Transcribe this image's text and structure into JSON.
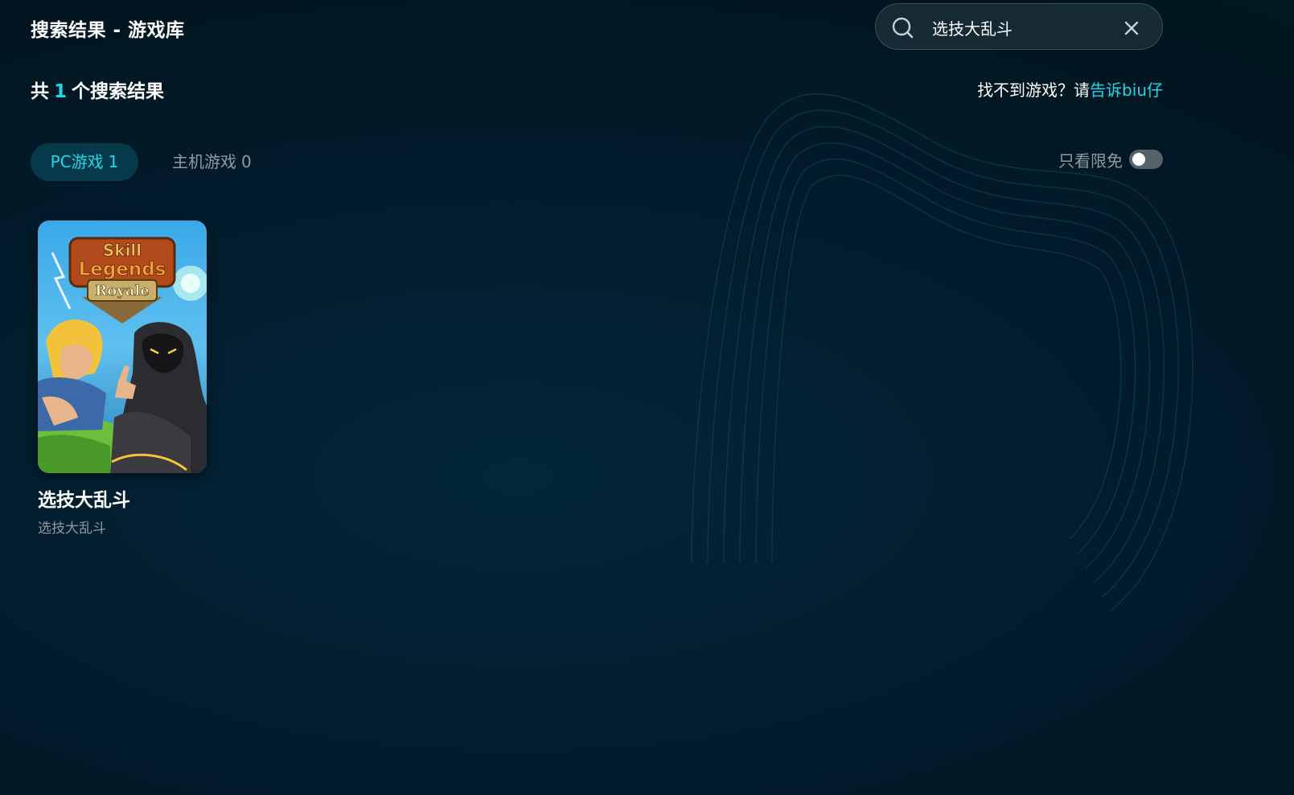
{
  "header": {
    "title": "搜索结果 - 游戏库"
  },
  "search": {
    "value": "选技大乱斗",
    "search_icon": "search-icon",
    "clear_icon": "close-icon"
  },
  "results": {
    "prefix": "共",
    "count": "1",
    "suffix": "个搜索结果"
  },
  "help": {
    "text": "找不到游戏？请",
    "link": "告诉biu仔"
  },
  "tabs": [
    {
      "label": "PC游戏",
      "count": "1",
      "active": true
    },
    {
      "label": "主机游戏",
      "count": "0",
      "active": false
    }
  ],
  "filter": {
    "free_only_label": "只看限免",
    "free_only_on": false
  },
  "games": [
    {
      "title": "选技大乱斗",
      "subtitle": "选技大乱斗",
      "cover_logo_line1": "Skill",
      "cover_logo_line2": "Legends",
      "cover_logo_line3": "Royale"
    }
  ],
  "colors": {
    "accent": "#1ed8ec",
    "muted": "#8e9aa0",
    "tab_active_bg": "#063a4a",
    "background": "#021b2a"
  }
}
